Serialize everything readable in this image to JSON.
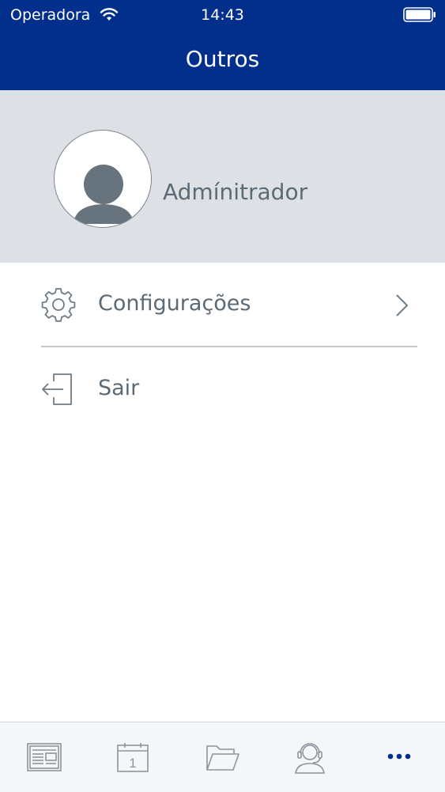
{
  "status_bar": {
    "carrier": "Operadora",
    "time": "14:43"
  },
  "nav": {
    "title": "Outros"
  },
  "profile": {
    "name": "Admínitrador"
  },
  "menu": {
    "items": [
      {
        "label": "Configurações",
        "icon": "gear-icon"
      },
      {
        "label": "Sair",
        "icon": "logout-icon"
      }
    ]
  },
  "tabbar": {
    "tabs": [
      {
        "icon": "news-icon"
      },
      {
        "icon": "calendar-icon",
        "badge": "1"
      },
      {
        "icon": "folder-icon"
      },
      {
        "icon": "support-headset-icon"
      },
      {
        "icon": "more-dots-icon",
        "active": true
      }
    ]
  },
  "colors": {
    "header_bg": "#022f8c",
    "profile_bg": "#dde1e5",
    "text_gray": "#5c6a76",
    "icon_gray": "#6f7b84",
    "active_blue": "#022f8c"
  }
}
